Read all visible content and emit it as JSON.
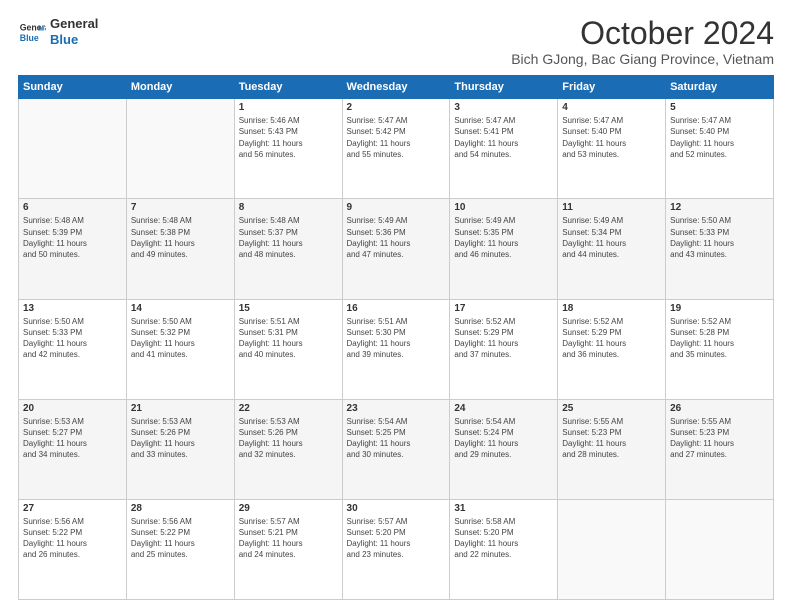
{
  "logo": {
    "line1": "General",
    "line2": "Blue"
  },
  "title": "October 2024",
  "subtitle": "Bich GJong, Bac Giang Province, Vietnam",
  "headers": [
    "Sunday",
    "Monday",
    "Tuesday",
    "Wednesday",
    "Thursday",
    "Friday",
    "Saturday"
  ],
  "weeks": [
    [
      {
        "num": "",
        "detail": ""
      },
      {
        "num": "",
        "detail": ""
      },
      {
        "num": "1",
        "detail": "Sunrise: 5:46 AM\nSunset: 5:43 PM\nDaylight: 11 hours\nand 56 minutes."
      },
      {
        "num": "2",
        "detail": "Sunrise: 5:47 AM\nSunset: 5:42 PM\nDaylight: 11 hours\nand 55 minutes."
      },
      {
        "num": "3",
        "detail": "Sunrise: 5:47 AM\nSunset: 5:41 PM\nDaylight: 11 hours\nand 54 minutes."
      },
      {
        "num": "4",
        "detail": "Sunrise: 5:47 AM\nSunset: 5:40 PM\nDaylight: 11 hours\nand 53 minutes."
      },
      {
        "num": "5",
        "detail": "Sunrise: 5:47 AM\nSunset: 5:40 PM\nDaylight: 11 hours\nand 52 minutes."
      }
    ],
    [
      {
        "num": "6",
        "detail": "Sunrise: 5:48 AM\nSunset: 5:39 PM\nDaylight: 11 hours\nand 50 minutes."
      },
      {
        "num": "7",
        "detail": "Sunrise: 5:48 AM\nSunset: 5:38 PM\nDaylight: 11 hours\nand 49 minutes."
      },
      {
        "num": "8",
        "detail": "Sunrise: 5:48 AM\nSunset: 5:37 PM\nDaylight: 11 hours\nand 48 minutes."
      },
      {
        "num": "9",
        "detail": "Sunrise: 5:49 AM\nSunset: 5:36 PM\nDaylight: 11 hours\nand 47 minutes."
      },
      {
        "num": "10",
        "detail": "Sunrise: 5:49 AM\nSunset: 5:35 PM\nDaylight: 11 hours\nand 46 minutes."
      },
      {
        "num": "11",
        "detail": "Sunrise: 5:49 AM\nSunset: 5:34 PM\nDaylight: 11 hours\nand 44 minutes."
      },
      {
        "num": "12",
        "detail": "Sunrise: 5:50 AM\nSunset: 5:33 PM\nDaylight: 11 hours\nand 43 minutes."
      }
    ],
    [
      {
        "num": "13",
        "detail": "Sunrise: 5:50 AM\nSunset: 5:33 PM\nDaylight: 11 hours\nand 42 minutes."
      },
      {
        "num": "14",
        "detail": "Sunrise: 5:50 AM\nSunset: 5:32 PM\nDaylight: 11 hours\nand 41 minutes."
      },
      {
        "num": "15",
        "detail": "Sunrise: 5:51 AM\nSunset: 5:31 PM\nDaylight: 11 hours\nand 40 minutes."
      },
      {
        "num": "16",
        "detail": "Sunrise: 5:51 AM\nSunset: 5:30 PM\nDaylight: 11 hours\nand 39 minutes."
      },
      {
        "num": "17",
        "detail": "Sunrise: 5:52 AM\nSunset: 5:29 PM\nDaylight: 11 hours\nand 37 minutes."
      },
      {
        "num": "18",
        "detail": "Sunrise: 5:52 AM\nSunset: 5:29 PM\nDaylight: 11 hours\nand 36 minutes."
      },
      {
        "num": "19",
        "detail": "Sunrise: 5:52 AM\nSunset: 5:28 PM\nDaylight: 11 hours\nand 35 minutes."
      }
    ],
    [
      {
        "num": "20",
        "detail": "Sunrise: 5:53 AM\nSunset: 5:27 PM\nDaylight: 11 hours\nand 34 minutes."
      },
      {
        "num": "21",
        "detail": "Sunrise: 5:53 AM\nSunset: 5:26 PM\nDaylight: 11 hours\nand 33 minutes."
      },
      {
        "num": "22",
        "detail": "Sunrise: 5:53 AM\nSunset: 5:26 PM\nDaylight: 11 hours\nand 32 minutes."
      },
      {
        "num": "23",
        "detail": "Sunrise: 5:54 AM\nSunset: 5:25 PM\nDaylight: 11 hours\nand 30 minutes."
      },
      {
        "num": "24",
        "detail": "Sunrise: 5:54 AM\nSunset: 5:24 PM\nDaylight: 11 hours\nand 29 minutes."
      },
      {
        "num": "25",
        "detail": "Sunrise: 5:55 AM\nSunset: 5:23 PM\nDaylight: 11 hours\nand 28 minutes."
      },
      {
        "num": "26",
        "detail": "Sunrise: 5:55 AM\nSunset: 5:23 PM\nDaylight: 11 hours\nand 27 minutes."
      }
    ],
    [
      {
        "num": "27",
        "detail": "Sunrise: 5:56 AM\nSunset: 5:22 PM\nDaylight: 11 hours\nand 26 minutes."
      },
      {
        "num": "28",
        "detail": "Sunrise: 5:56 AM\nSunset: 5:22 PM\nDaylight: 11 hours\nand 25 minutes."
      },
      {
        "num": "29",
        "detail": "Sunrise: 5:57 AM\nSunset: 5:21 PM\nDaylight: 11 hours\nand 24 minutes."
      },
      {
        "num": "30",
        "detail": "Sunrise: 5:57 AM\nSunset: 5:20 PM\nDaylight: 11 hours\nand 23 minutes."
      },
      {
        "num": "31",
        "detail": "Sunrise: 5:58 AM\nSunset: 5:20 PM\nDaylight: 11 hours\nand 22 minutes."
      },
      {
        "num": "",
        "detail": ""
      },
      {
        "num": "",
        "detail": ""
      }
    ]
  ]
}
